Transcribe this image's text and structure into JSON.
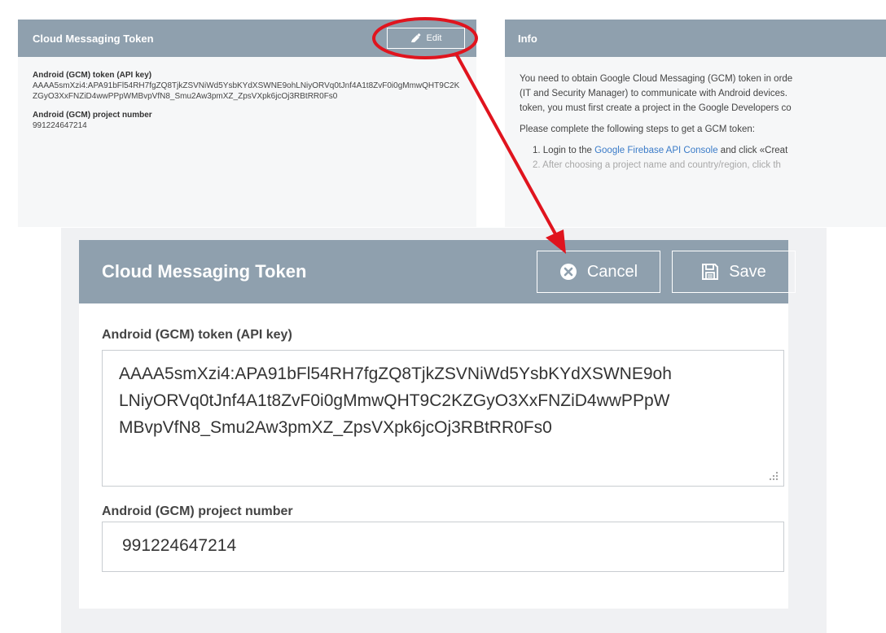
{
  "background": {
    "left_panel": {
      "title": "Cloud Messaging Token",
      "edit_label": "Edit",
      "token_label": "Android (GCM) token (API key)",
      "token_value": "AAAA5smXzi4:APA91bFl54RH7fgZQ8TjkZSVNiWd5YsbKYdXSWNE9ohLNiyORVq0tJnf4A1t8ZvF0i0gMmwQHT9C2KZGyO3XxFNZiD4wwPPpWMBvpVfN8_Smu2Aw3pmXZ_ZpsVXpk6jcOj3RBtRR0Fs0",
      "project_label": "Android (GCM) project number",
      "project_value": "991224647214"
    },
    "right_panel": {
      "title": "Info",
      "line1": "You need to obtain Google Cloud Messaging (GCM) token in orde",
      "line2": "(IT and Security Manager) to communicate with Android devices.",
      "line3": "token, you must first create a project in the Google Developers co",
      "line4": "Please complete the following steps to get a GCM token:",
      "step1_prefix": "1. Login to the ",
      "step1_link": "Google Firebase API Console",
      "step1_suffix": " and click «Creat",
      "step2": "2. After choosing a project name and country/region, click th"
    }
  },
  "dialog": {
    "title": "Cloud Messaging Token",
    "cancel_label": "Cancel",
    "save_label": "Save",
    "token_label": "Android (GCM) token (API key)",
    "token_line1": "AAAA5smXzi4:APA91bFl54RH7fgZQ8TjkZSVNiWd5YsbKYdXSWNE9oh",
    "token_line2": "LNiyORVq0tJnf4A1t8ZvF0i0gMmwQHT9C2KZGyO3XxFNZiD4wwPPpW",
    "token_line3": "MBvpVfN8_Smu2Aw3pmXZ_ZpsVXpk6jcOj3RBtRR0Fs0",
    "project_label": "Android (GCM) project number",
    "project_value": "991224647214"
  },
  "colors": {
    "header": "#8fa0ae",
    "annotation": "#e0141e",
    "link": "#3a7bc8"
  },
  "icons": [
    "edit-pencil-icon",
    "cancel-x-circle-icon",
    "save-floppy-icon",
    "resize-grip-icon"
  ]
}
